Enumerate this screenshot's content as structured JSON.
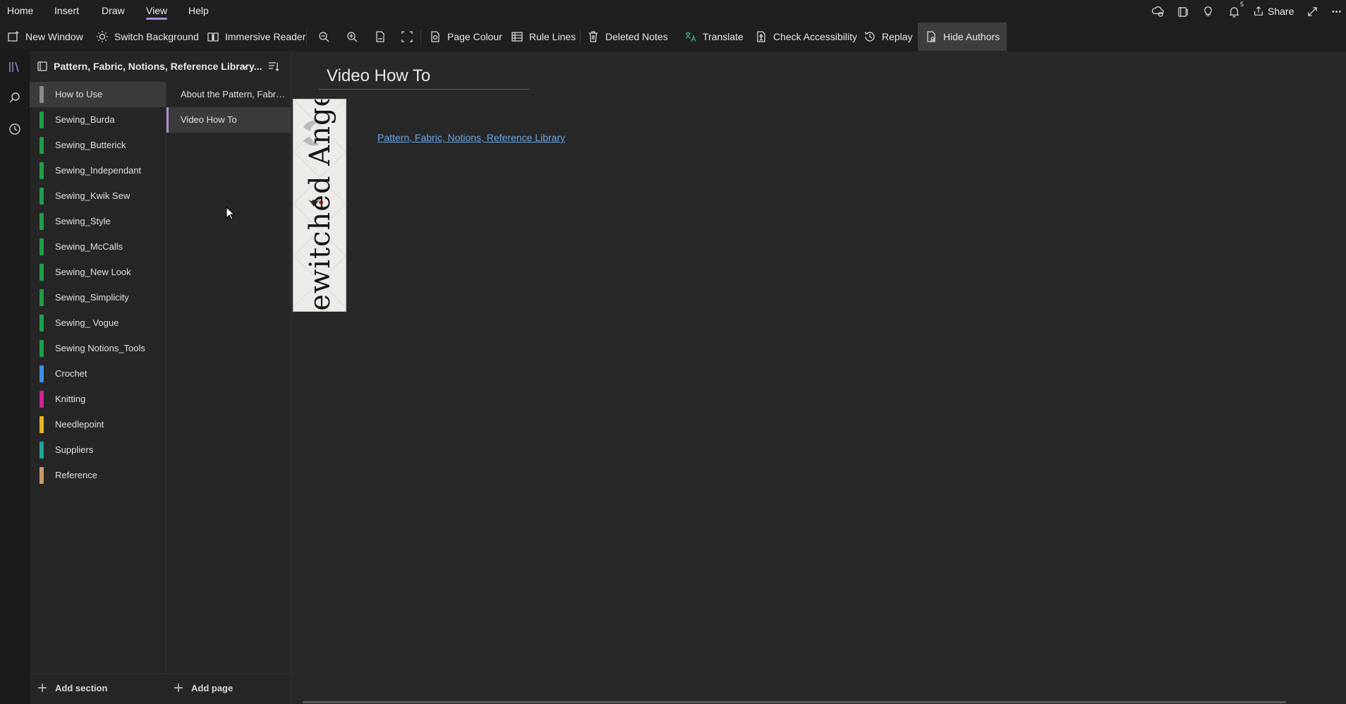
{
  "menu": {
    "items": [
      {
        "label": "Home"
      },
      {
        "label": "Insert"
      },
      {
        "label": "Draw"
      },
      {
        "label": "View"
      },
      {
        "label": "Help"
      }
    ],
    "active": "View",
    "share_label": "Share",
    "notification_count": "5",
    "icons": [
      "sync-status-icon",
      "notebook-pane-icon",
      "lightbulb-icon",
      "bell-icon",
      "share-icon",
      "fullscreen-icon",
      "more-options-icon"
    ]
  },
  "ribbon": {
    "new_window": "New Window",
    "switch_background": "Switch Background",
    "immersive_reader": "Immersive Reader",
    "page_colour": "Page Colour",
    "rule_lines": "Rule Lines",
    "deleted_notes": "Deleted Notes",
    "translate": "Translate",
    "check_accessibility": "Check Accessibility",
    "replay": "Replay",
    "hide_authors": "Hide Authors",
    "icons": [
      "zoom-out-icon",
      "zoom-in-icon",
      "zoom-100-icon",
      "page-width-icon"
    ]
  },
  "notebook": {
    "title": "Pattern, Fabric, Notions, Reference Library..."
  },
  "sections": [
    {
      "label": "How to Use",
      "color": "#8a8a8a"
    },
    {
      "label": "Sewing_Burda",
      "color": "#1e9e48"
    },
    {
      "label": "Sewing_Butterick",
      "color": "#1e9e48"
    },
    {
      "label": "Sewing_Independant",
      "color": "#1e9e48"
    },
    {
      "label": "Sewing_Kwik Sew",
      "color": "#1e9e48"
    },
    {
      "label": "Sewing_Style",
      "color": "#1e9e48"
    },
    {
      "label": "Sewing_McCalls",
      "color": "#1e9e48"
    },
    {
      "label": "Sewing_New Look",
      "color": "#1e9e48"
    },
    {
      "label": "Sewing_Simplicity",
      "color": "#1e9e48"
    },
    {
      "label": "Sewing_ Vogue",
      "color": "#1e9e48"
    },
    {
      "label": "Sewing Notions_Tools",
      "color": "#1e9e48"
    },
    {
      "label": "Crochet",
      "color": "#3b8ee6"
    },
    {
      "label": "Knitting",
      "color": "#d4209a"
    },
    {
      "label": "Needlepoint",
      "color": "#e6b51e"
    },
    {
      "label": "Suppliers",
      "color": "#1fa59a"
    },
    {
      "label": "Reference",
      "color": "#c49a6c"
    }
  ],
  "selected_section": "How to Use",
  "pages": [
    {
      "label": "About the Pattern, Fabric, Notions, Reference Library"
    },
    {
      "label": "Video How To"
    }
  ],
  "selected_page": "Video How To",
  "bottom": {
    "add_section": "Add section",
    "add_page": "Add page"
  },
  "page": {
    "title": "Video How To",
    "banner_text": "Bewitched Angel",
    "link_text": "Pattern, Fabric, Notions, Reference Library"
  },
  "colors": {
    "accent": "#a88fd6",
    "link": "#6aa6e8",
    "background": "#262626"
  }
}
